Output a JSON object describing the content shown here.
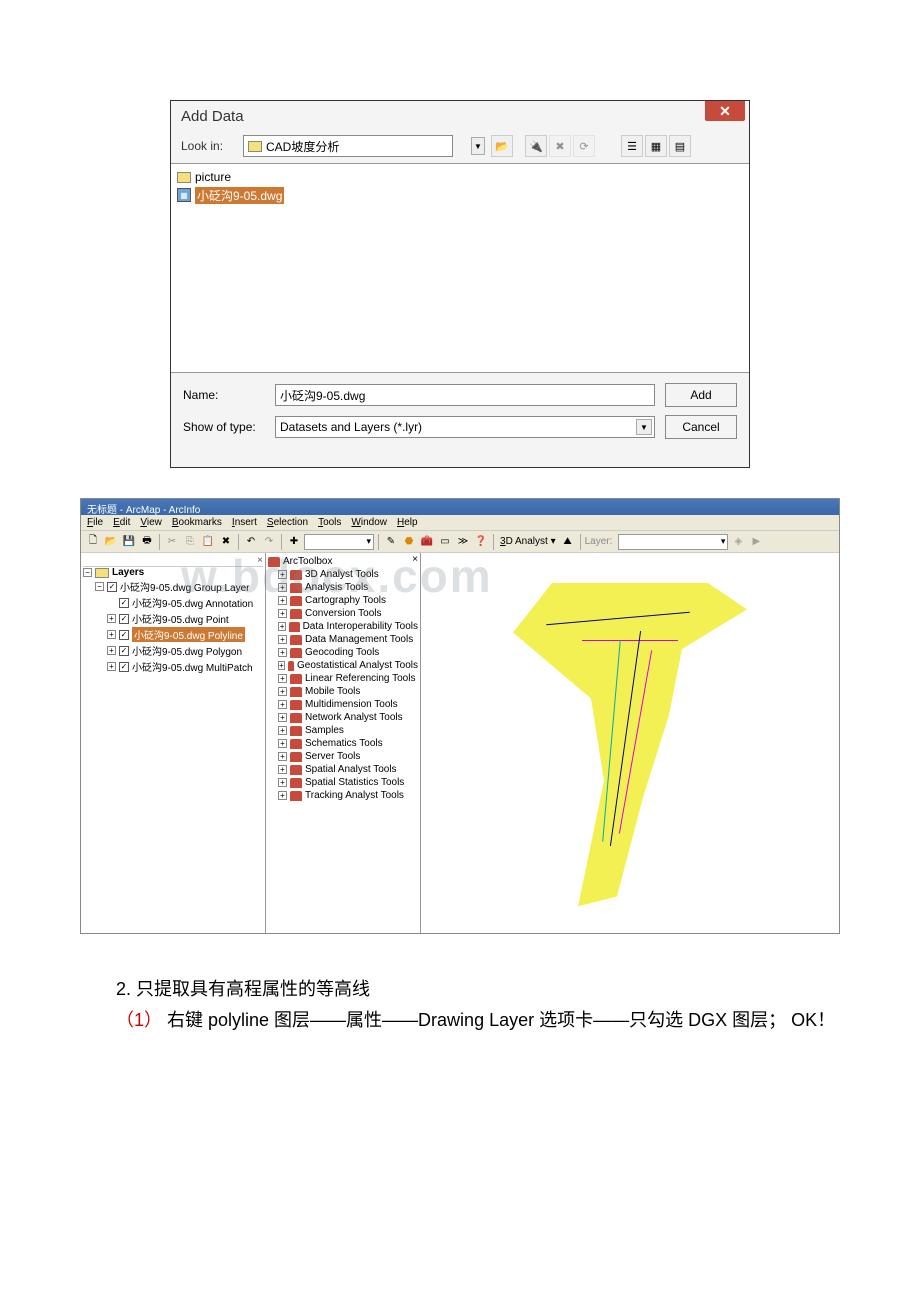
{
  "dialog": {
    "title": "Add Data",
    "close": "✕",
    "lookin_label": "Look in:",
    "lookin_value": "CAD坡度分析",
    "files": {
      "picture": "picture",
      "dwg": "小砭沟9-05.dwg"
    },
    "name_label": "Name:",
    "name_value": "小砭沟9-05.dwg",
    "type_label": "Show of type:",
    "type_value": "Datasets and Layers (*.lyr)",
    "add_btn": "Add",
    "cancel_btn": "Cancel"
  },
  "arcmap": {
    "title": "无标题 - ArcMap - ArcInfo",
    "menu": {
      "file": "File",
      "edit": "Edit",
      "view": "View",
      "bookmarks": "Bookmarks",
      "insert": "Insert",
      "selection": "Selection",
      "tools": "Tools",
      "window": "Window",
      "help": "Help"
    },
    "toolbar": {
      "analyst": "3D Analyst",
      "layer_label": "Layer:"
    },
    "toc": {
      "root": "Layers",
      "group": "小砭沟9-05.dwg Group Layer",
      "annotation": "小砭沟9-05.dwg Annotation",
      "point": "小砭沟9-05.dwg Point",
      "polyline": "小砭沟9-05.dwg Polyline",
      "polygon": "小砭沟9-05.dwg Polygon",
      "multipatch": "小砭沟9-05.dwg MultiPatch"
    },
    "toolbox": {
      "root": "ArcToolbox",
      "t1": "3D Analyst Tools",
      "t2": "Analysis Tools",
      "t3": "Cartography Tools",
      "t4": "Conversion Tools",
      "t5": "Data Interoperability Tools",
      "t6": "Data Management Tools",
      "t7": "Geocoding Tools",
      "t8": "Geostatistical Analyst Tools",
      "t9": "Linear Referencing Tools",
      "t10": "Mobile Tools",
      "t11": "Multidimension Tools",
      "t12": "Network Analyst Tools",
      "t13": "Samples",
      "t14": "Schematics Tools",
      "t15": "Server Tools",
      "t16": "Spatial Analyst Tools",
      "t17": "Spatial Statistics Tools",
      "t18": "Tracking Analyst Tools"
    }
  },
  "watermark": "w.bdocx.com",
  "doc": {
    "step2": "2. 只提取具有高程属性的等高线",
    "step2_1a": "（1）",
    "step2_1b": " 右键 polyline 图层——属性——Drawing Layer 选项卡——只勾选 DGX 图层； OK！"
  }
}
